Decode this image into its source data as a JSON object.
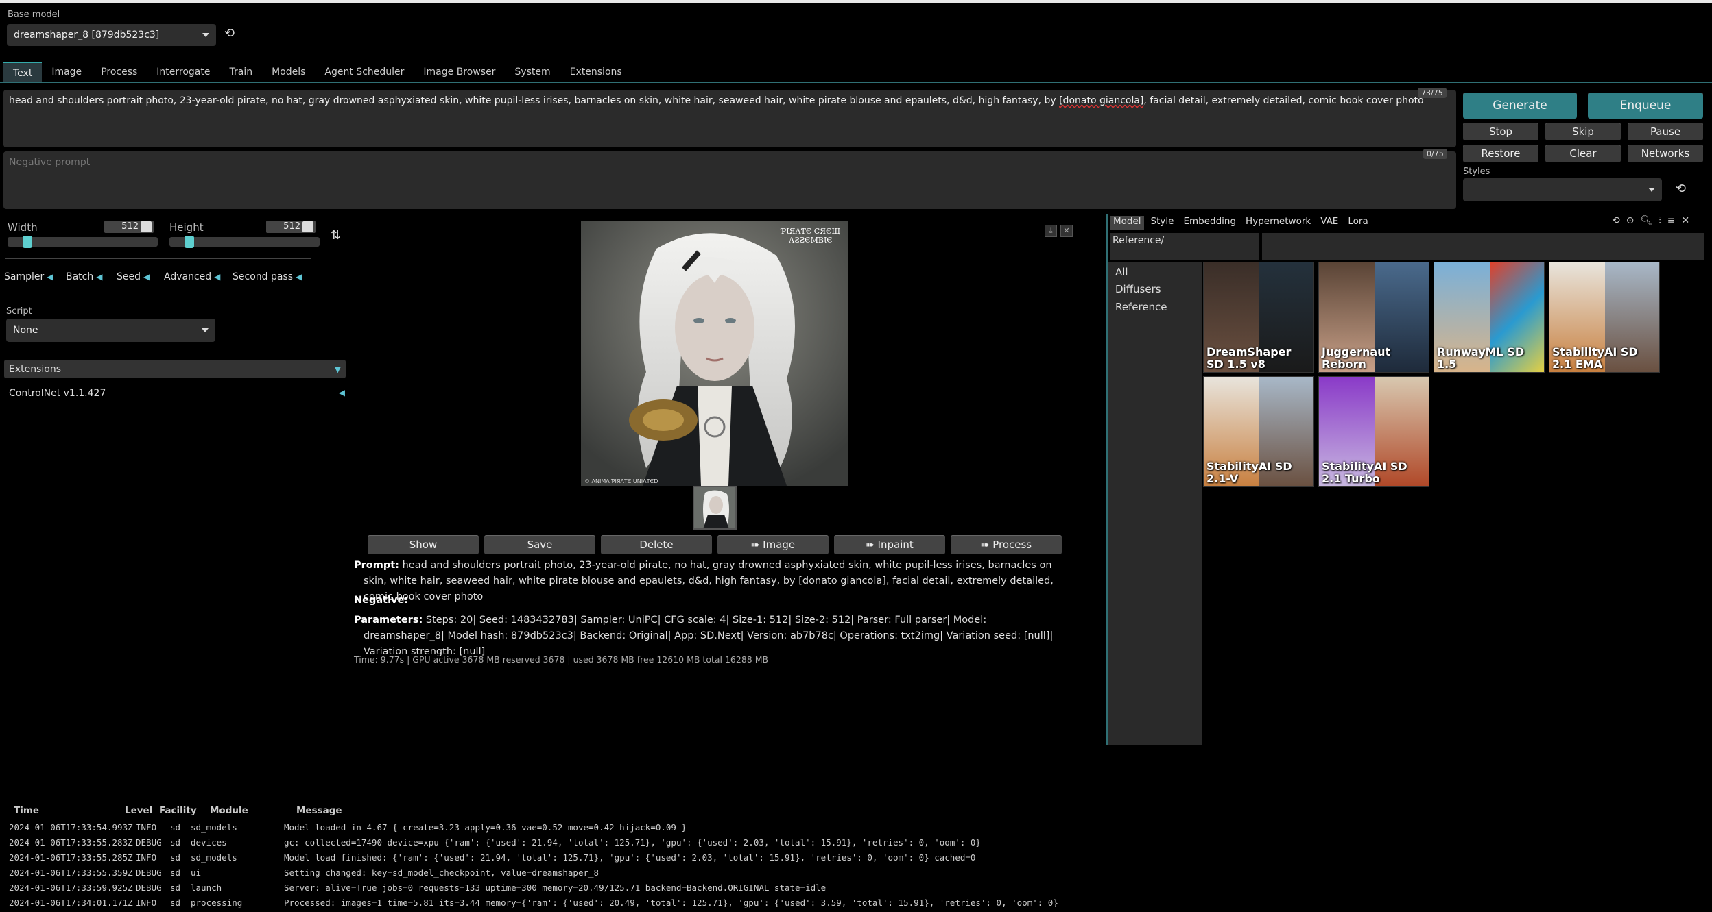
{
  "base_model": {
    "label": "Base model",
    "value": "dreamshaper_8 [879db523c3]"
  },
  "tabs": [
    "Text",
    "Image",
    "Process",
    "Interrogate",
    "Train",
    "Models",
    "Agent Scheduler",
    "Image Browser",
    "System",
    "Extensions"
  ],
  "prompt": {
    "text_before": "head and shoulders portrait photo, 23-year-old pirate, no hat, gray drowned asphyxiated skin, white pupil-less irises, barnacles on skin, white hair, seaweed hair, white pirate blouse and epaulets, d&d, high fantasy, by ",
    "text_misspelled": "[donato giancola]",
    "text_after": ", facial detail, extremely detailed, comic book cover photo",
    "counter": "73/75"
  },
  "negative_prompt": {
    "placeholder": "Negative prompt",
    "counter": "0/75"
  },
  "buttons": {
    "generate": "Generate",
    "enqueue": "Enqueue",
    "stop": "Stop",
    "skip": "Skip",
    "pause": "Pause",
    "restore": "Restore",
    "clear": "Clear",
    "networks": "Networks"
  },
  "styles_label": "Styles",
  "width": {
    "label": "Width",
    "value": "512",
    "fraction": 0.1
  },
  "height": {
    "label": "Height",
    "value": "512",
    "fraction": 0.1
  },
  "accordions": [
    "Sampler",
    "Batch",
    "Seed",
    "Advanced",
    "Second pass"
  ],
  "script": {
    "label": "Script",
    "value": "None"
  },
  "extensions": {
    "label": "Extensions",
    "items": [
      "ControlNet v1.1.427"
    ]
  },
  "image_actions": [
    "Show",
    "Save",
    "Delete",
    "➠ Image",
    "➠ Inpaint",
    "➠ Process"
  ],
  "info": {
    "prompt_label": "Prompt:",
    "prompt_text": "head and shoulders portrait photo, 23-year-old pirate, no hat, gray drowned asphyxiated skin, white pupil-less irises, barnacles on skin, white hair, seaweed hair, white pirate blouse and epaulets, d&d, high fantasy, by [donato giancola], facial detail, extremely detailed, comic book cover photo",
    "negative_label": "Negative:",
    "params_label": "Parameters:",
    "params_text": "Steps: 20| Seed: 1483432783| Sampler: UniPC| CFG scale: 4| Size-1: 512| Size-2: 512| Parser: Full parser| Model: dreamshaper_8| Model hash: 879db523c3| Backend: Original| App: SD.Next| Version: ab7b78c| Operations: txt2img| Variation seed: [null]| Variation strength: [null]",
    "time": "Time: 9.77s | GPU active 3678 MB reserved 3678 | used 3678 MB free 12610 MB total 16288 MB"
  },
  "image_watermark": "ƤƖЯΛƬЄ CЯЄЩ\nΛƧƧЄMƁƖЄ",
  "image_caption": "© ΛNIMΛ ƤIЯΛƬЄ UNIΛƬЄƊ",
  "networks": {
    "tabs": [
      "Model",
      "Style",
      "Embedding",
      "Hypernetwork",
      "VAE",
      "Lora"
    ],
    "path": "Reference/",
    "folders": [
      "All",
      "Diffusers",
      "Reference"
    ],
    "cards": [
      "DreamShaper SD 1.5 v8",
      "Juggernaut Reborn",
      "RunwayML SD 1.5",
      "StabilityAI SD 2.1 EMA",
      "StabilityAI SD 2.1-V",
      "StabilityAI SD 2.1 Turbo"
    ]
  },
  "log": {
    "headers": [
      "Time",
      "Level",
      "Facility",
      "Module",
      "Message"
    ],
    "rows": [
      [
        "2024-01-06T17:33:54.993Z",
        "INFO",
        "sd",
        "sd_models",
        "Model loaded in 4.67 { create=3.23 apply=0.36 vae=0.52 move=0.42 hijack=0.09 }"
      ],
      [
        "2024-01-06T17:33:55.283Z",
        "DEBUG",
        "sd",
        "devices",
        "gc: collected=17490 device=xpu {'ram': {'used': 21.94, 'total': 125.71}, 'gpu': {'used': 2.03, 'total': 15.91}, 'retries': 0, 'oom': 0}"
      ],
      [
        "2024-01-06T17:33:55.285Z",
        "INFO",
        "sd",
        "sd_models",
        "Model load finished: {'ram': {'used': 21.94, 'total': 125.71}, 'gpu': {'used': 2.03, 'total': 15.91}, 'retries': 0, 'oom': 0} cached=0"
      ],
      [
        "2024-01-06T17:33:55.359Z",
        "DEBUG",
        "sd",
        "ui",
        "Setting changed: key=sd_model_checkpoint, value=dreamshaper_8"
      ],
      [
        "2024-01-06T17:33:59.925Z",
        "DEBUG",
        "sd",
        "launch",
        "Server: alive=True jobs=0 requests=133 uptime=300 memory=20.49/125.71 backend=Backend.ORIGINAL state=idle"
      ],
      [
        "2024-01-06T17:34:01.171Z",
        "INFO",
        "sd",
        "processing",
        "Processed: images=1 time=5.81 its=3.44 memory={'ram': {'used': 20.49, 'total': 125.71}, 'gpu': {'used': 3.59, 'total': 15.91}, 'retries': 0, 'oom': 0}"
      ]
    ]
  }
}
